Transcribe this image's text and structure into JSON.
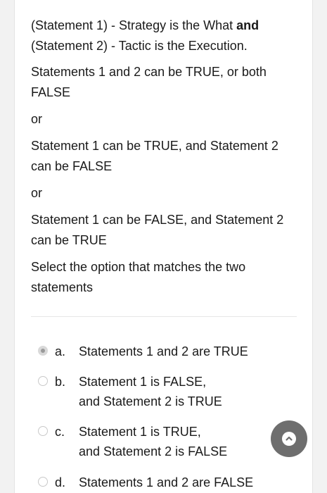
{
  "question": {
    "line1_prefix": "(Statement 1) - Strategy is the What ",
    "line1_bold": "and",
    "line2": "(Statement 2) - Tactic is the Execution.",
    "para2": "Statements 1 and 2 can be TRUE, or both FALSE",
    "or1": "or",
    "para3": "Statement 1 can be TRUE, and Statement 2 can be FALSE",
    "or2": "or",
    "para4": "Statement 1 can be FALSE, and Statement 2 can be TRUE",
    "prompt": "Select the option that matches the two statements"
  },
  "options": [
    {
      "letter": "a.",
      "line1": "Statements 1 and 2 are TRUE",
      "line2": "",
      "selected": true
    },
    {
      "letter": "b.",
      "line1": "Statement 1 is FALSE,",
      "line2": "and Statement 2 is TRUE",
      "selected": false
    },
    {
      "letter": "c.",
      "line1": "Statement 1 is TRUE,",
      "line2": "and Statement 2 is FALSE",
      "selected": false
    },
    {
      "letter": "d.",
      "line1": "Statements 1 and 2 are FALSE",
      "line2": "",
      "selected": false
    }
  ],
  "scroll_button": {
    "icon": "chevron-up-icon",
    "color": "#6e6e6e"
  }
}
